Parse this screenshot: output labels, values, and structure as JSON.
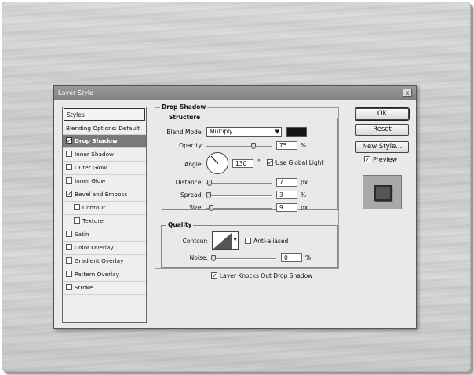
{
  "dialog": {
    "title": "Layer Style",
    "close_glyph": "x"
  },
  "styles_list": {
    "header": "Styles",
    "items": [
      {
        "label": "Blending Options: Default",
        "checkbox": false,
        "checked": false,
        "selected": false,
        "sub": false
      },
      {
        "label": "Drop Shadow",
        "checkbox": true,
        "checked": true,
        "selected": true,
        "sub": false
      },
      {
        "label": "Inner Shadow",
        "checkbox": true,
        "checked": false,
        "selected": false,
        "sub": false
      },
      {
        "label": "Outer Glow",
        "checkbox": true,
        "checked": false,
        "selected": false,
        "sub": false
      },
      {
        "label": "Inner Glow",
        "checkbox": true,
        "checked": false,
        "selected": false,
        "sub": false
      },
      {
        "label": "Bevel and Emboss",
        "checkbox": true,
        "checked": true,
        "selected": false,
        "sub": false
      },
      {
        "label": "Contour",
        "checkbox": true,
        "checked": false,
        "selected": false,
        "sub": true
      },
      {
        "label": "Texture",
        "checkbox": true,
        "checked": false,
        "selected": false,
        "sub": true
      },
      {
        "label": "Satin",
        "checkbox": true,
        "checked": false,
        "selected": false,
        "sub": false
      },
      {
        "label": "Color Overlay",
        "checkbox": true,
        "checked": false,
        "selected": false,
        "sub": false
      },
      {
        "label": "Gradient Overlay",
        "checkbox": true,
        "checked": false,
        "selected": false,
        "sub": false
      },
      {
        "label": "Pattern Overlay",
        "checkbox": true,
        "checked": false,
        "selected": false,
        "sub": false
      },
      {
        "label": "Stroke",
        "checkbox": true,
        "checked": false,
        "selected": false,
        "sub": false
      }
    ]
  },
  "drop_shadow": {
    "title": "Drop Shadow",
    "structure": {
      "title": "Structure",
      "blend_mode_label": "Blend Mode:",
      "blend_mode_value": "Multiply",
      "shadow_color": "#151515",
      "opacity_label": "Opacity:",
      "opacity_value": "75",
      "opacity_unit": "%",
      "angle_label": "Angle:",
      "angle_value": "130",
      "angle_unit": "°",
      "use_global_light_label": "Use Global Light",
      "use_global_light_checked": true,
      "distance_label": "Distance:",
      "distance_value": "7",
      "distance_unit": "px",
      "spread_label": "Spread:",
      "spread_value": "3",
      "spread_unit": "%",
      "size_label": "Size:",
      "size_value": "9",
      "size_unit": "px"
    },
    "quality": {
      "title": "Quality",
      "contour_label": "Contour:",
      "anti_aliased_label": "Anti-aliased",
      "anti_aliased_checked": false,
      "noise_label": "Noise:",
      "noise_value": "0",
      "noise_unit": "%"
    },
    "knockout_label": "Layer Knocks Out Drop Shadow",
    "knockout_checked": true
  },
  "buttons": {
    "ok": "OK",
    "reset": "Reset",
    "new_style": "New Style...",
    "preview_label": "Preview",
    "preview_checked": true
  }
}
